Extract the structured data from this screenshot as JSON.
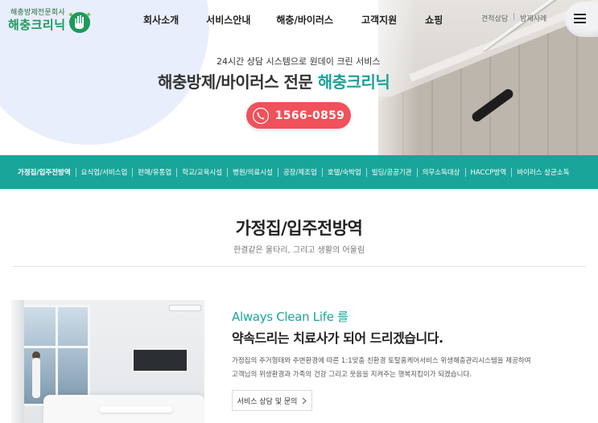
{
  "brand": {
    "tagline": "해충방제전문회사",
    "name": "해충크리닉",
    "mark_icon": "hand-shield-logo-icon"
  },
  "nav": {
    "items": [
      "회사소개",
      "서비스안내",
      "해충/바이러스",
      "고객지원",
      "쇼핑"
    ],
    "utility": [
      "견적상담",
      "방제사례"
    ],
    "menu_icon": "hamburger-icon"
  },
  "hero": {
    "kicker": "24시간 상담 시스템으로 원데이 크린 서비스",
    "title_main": "해충방제/바이러스 전문",
    "title_accent": "해충크리닉",
    "phone": "1566-0859",
    "phone_icon": "phone-icon"
  },
  "categories": {
    "active_index": 0,
    "items": [
      "가정집/입주전방역",
      "요식업/서비스업",
      "판매/유통업",
      "학교/교육시설",
      "병원/의료시설",
      "공장/제조업",
      "호텔/숙박업",
      "빌딩/공공기관",
      "의무소독대상",
      "HACCP방역",
      "바이러스 살균소독"
    ]
  },
  "section": {
    "title": "가정집/입주전방역",
    "subtitle": "한결같은 울타리, 그리고 생활의 어울림"
  },
  "content": {
    "eng_line": "Always Clean Life 를",
    "headline": "약속드리는 치료사가 되어 드리겠습니다.",
    "body_line1": "가정집의 주거형태와 주변환경에 따른 1:1맞춤 친환경 토탈홈케어서비스 위생해충관리시스템을 제공하여",
    "body_line2": "고객님의 위생환경과 가족의 건강 그리고 웃음을 지켜주는 행복지킴이가 되겠습니다.",
    "button_label": "서비스 상담 및 문의",
    "button_icon": "chevron-right-icon"
  },
  "colors": {
    "brand_green": "#1d9a5b",
    "teal_accent": "#1aa59a",
    "phone_red": "#f0515a",
    "hero_blob": "#e8eefc"
  }
}
